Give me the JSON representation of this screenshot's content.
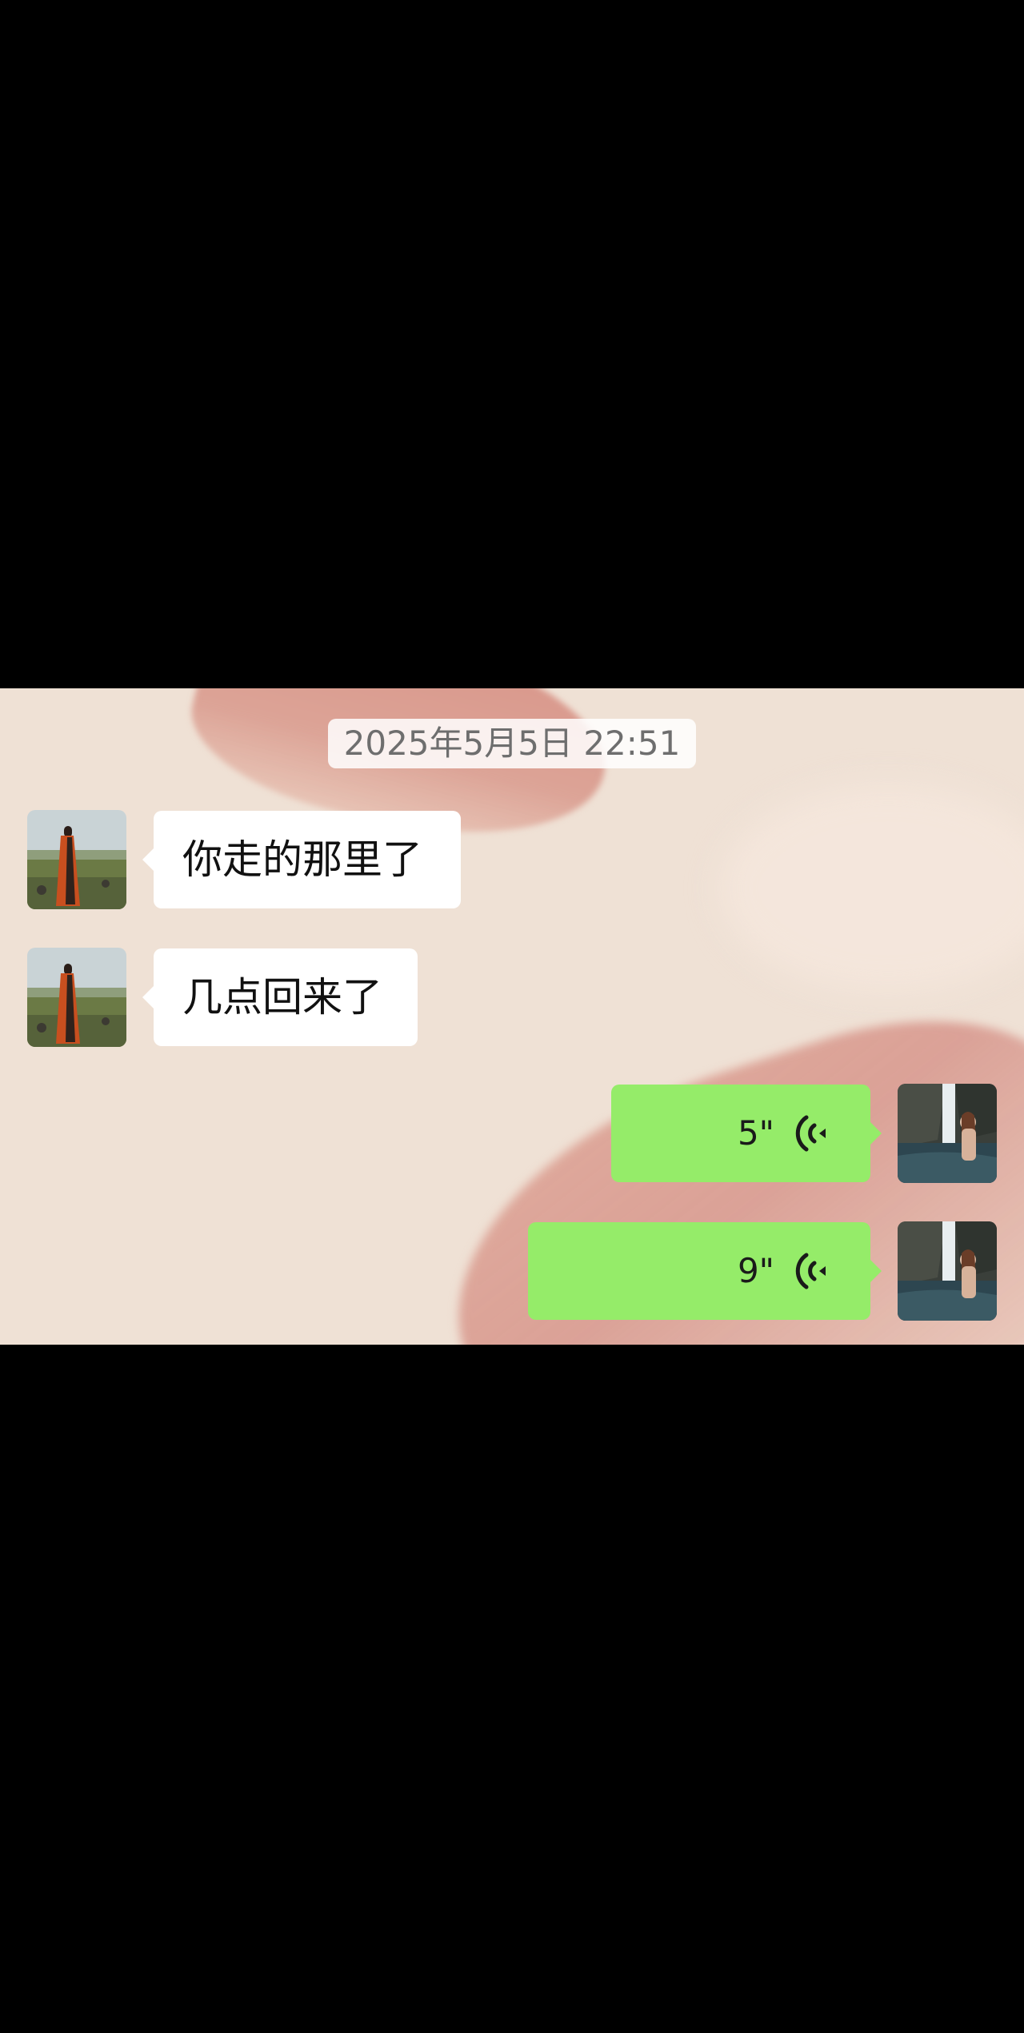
{
  "chat": {
    "timestamp": "2025年5月5日 22:51",
    "messages": [
      {
        "direction": "incoming",
        "type": "text",
        "text": "你走的那里了",
        "avatar": "contact-avatar"
      },
      {
        "direction": "incoming",
        "type": "text",
        "text": "几点回来了",
        "avatar": "contact-avatar"
      },
      {
        "direction": "outgoing",
        "type": "voice",
        "duration": "5\"",
        "icon": "voice-wave-icon",
        "avatar": "self-avatar"
      },
      {
        "direction": "outgoing",
        "type": "voice",
        "duration": "9\"",
        "icon": "voice-wave-icon",
        "avatar": "self-avatar"
      }
    ]
  },
  "colors": {
    "background": "#efe1d5",
    "incoming_bubble": "#ffffff",
    "outgoing_bubble": "#95ec69",
    "letterbox": "#000000"
  }
}
